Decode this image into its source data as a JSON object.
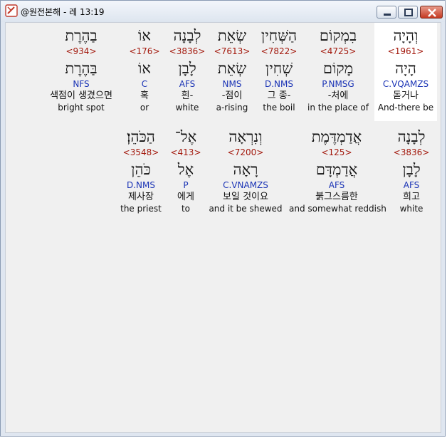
{
  "window": {
    "title": "@원전본해 - 레 13:19"
  },
  "verse": {
    "line1": [
      {
        "surface": "וְהָיָה",
        "strong": "<1961>",
        "lemma": "הָיָה",
        "morph": "C.VQAMZS",
        "kor": "돋거나",
        "eng": "And-there be"
      },
      {
        "surface": "בִמְקוֹם",
        "strong": "<4725>",
        "lemma": "מָקוֹם",
        "morph": "P.NMSG",
        "kor": "-처에",
        "eng": "in the place of"
      },
      {
        "surface": "הַשְּׁחִין",
        "strong": "<7822>",
        "lemma": "שְׁחִין",
        "morph": "D.NMS",
        "kor": "그 종-",
        "eng": "the boil"
      },
      {
        "surface": "שְׂאֵת",
        "strong": "<7613>",
        "lemma": "שְׂאֵת",
        "morph": "NMS",
        "kor": "-점이",
        "eng": "a-rising"
      },
      {
        "surface": "לְבָנָה",
        "strong": "<3836>",
        "lemma": "לָבָן",
        "morph": "AFS",
        "kor": "흰-",
        "eng": "white"
      },
      {
        "surface": "אוֹ",
        "strong": "<176>",
        "lemma": "אוֹ",
        "morph": "C",
        "kor": "혹",
        "eng": "or"
      },
      {
        "surface": "בַהֶרֶת",
        "strong": "<934>",
        "lemma": "בַּהֶרֶת",
        "morph": "NFS",
        "kor": "색점이 생겼으면",
        "eng": "bright spot"
      }
    ],
    "line2": [
      {
        "surface": "לְבָנָה",
        "strong": "<3836>",
        "lemma": "לָבָן",
        "morph": "AFS",
        "kor": "희고",
        "eng": "white"
      },
      {
        "surface": "אֲדַמְדֶּמֶת",
        "strong": "<125>",
        "lemma": "אֲדַמְדָּם",
        "morph": "AFS",
        "kor": "붉그스름한",
        "eng": "and somewhat reddish"
      },
      {
        "surface": "וְנִרְאָה",
        "strong": "<7200>",
        "lemma": "רָאָה",
        "morph": "C.VNAMZS",
        "kor": "보일 것이요",
        "eng": "and it be shewed"
      },
      {
        "surface": "אֶל־",
        "strong": "<413>",
        "lemma": "אֶל",
        "morph": "P",
        "kor": "에게",
        "eng": "to"
      },
      {
        "surface": "הַכֹּהֵן׃",
        "strong": "<3548>",
        "lemma": "כֹּהֵן",
        "morph": "D.NMS",
        "kor": "제사장",
        "eng": "the priest"
      }
    ]
  }
}
